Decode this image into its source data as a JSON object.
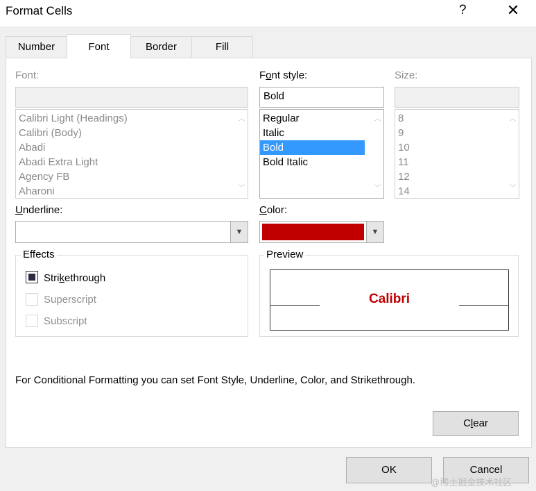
{
  "window": {
    "title": "Format Cells",
    "help_glyph": "?",
    "close_glyph": "✕"
  },
  "tabs": [
    {
      "label": "Number",
      "active": false
    },
    {
      "label": "Font",
      "active": true
    },
    {
      "label": "Border",
      "active": false
    },
    {
      "label": "Fill",
      "active": false
    }
  ],
  "font": {
    "label": "Font:",
    "value": "",
    "items": [
      "Calibri Light (Headings)",
      "Calibri (Body)",
      "Abadi",
      "Abadi Extra Light",
      "Agency FB",
      "Aharoni"
    ]
  },
  "font_style": {
    "label_pre": "F",
    "label_mid": "o",
    "label_post": "nt style:",
    "value": "Bold",
    "items": [
      "Regular",
      "Italic",
      "Bold",
      "Bold Italic"
    ],
    "selected": "Bold"
  },
  "size": {
    "label": "Size:",
    "value": "",
    "items": [
      "8",
      "9",
      "10",
      "11",
      "12",
      "14"
    ]
  },
  "underline": {
    "label_pre": "",
    "label_mid": "U",
    "label_post": "nderline:",
    "value": ""
  },
  "color": {
    "label_pre": "",
    "label_mid": "C",
    "label_post": "olor:",
    "swatch": "#c00000"
  },
  "effects": {
    "title": "Effects",
    "strikethrough": {
      "pre": "Stri",
      "mid": "k",
      "post": "ethrough",
      "checked": true
    },
    "superscript": {
      "label": "Superscript",
      "enabled": false
    },
    "subscript": {
      "label": "Subscript",
      "enabled": false
    }
  },
  "preview": {
    "title": "Preview",
    "sample": "Calibri",
    "sample_color": "#c00000"
  },
  "note": "For Conditional Formatting you can set Font Style, Underline, Color, and Strikethrough.",
  "buttons": {
    "clear": {
      "pre": "C",
      "mid": "l",
      "post": "ear"
    },
    "ok": "OK",
    "cancel": "Cancel"
  },
  "watermark": "@稀土掘金技术社区"
}
